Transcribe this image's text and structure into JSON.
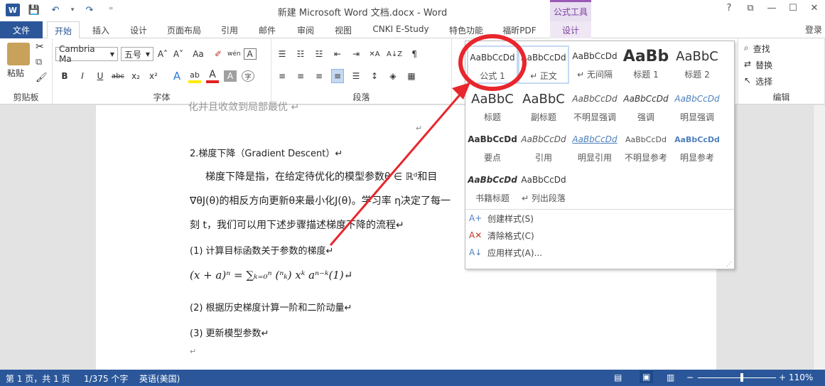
{
  "window": {
    "title": "新建 Microsoft Word 文档.docx - Word",
    "context_tab_title": "公式工具",
    "help": "?",
    "restore_ribbon": "⧉",
    "minimize": "—",
    "maximize": "☐",
    "close": "✕",
    "login": "登录"
  },
  "qat": {
    "logo": "W",
    "save": "💾",
    "undo": "↶",
    "undo_dd": "▾",
    "redo": "↷",
    "customize": "⁼"
  },
  "tabs": [
    {
      "label": "文件",
      "kind": "file"
    },
    {
      "label": "开始",
      "kind": "active"
    },
    {
      "label": "插入"
    },
    {
      "label": "设计"
    },
    {
      "label": "页面布局"
    },
    {
      "label": "引用"
    },
    {
      "label": "邮件"
    },
    {
      "label": "审阅"
    },
    {
      "label": "视图"
    },
    {
      "label": "CNKI E-Study"
    },
    {
      "label": "特色功能"
    },
    {
      "label": "福昕PDF"
    },
    {
      "label": "设计",
      "kind": "ctx"
    }
  ],
  "ribbon": {
    "clipboard": {
      "paste": "粘贴",
      "label": "剪贴板",
      "cut": "✂",
      "copy": "⧉",
      "brush": "🖌"
    },
    "font": {
      "family": "Cambria Ma",
      "size": "五号",
      "grow": "A˄",
      "shrink": "A˅",
      "case": "Aa",
      "clear": "✐",
      "phonetic": "wén",
      "border": "A",
      "bold": "B",
      "italic": "I",
      "underline": "U",
      "strike": "abc",
      "sub": "x₂",
      "sup": "x²",
      "effects": "A",
      "highlight": "ab",
      "color": "A",
      "shade": "A",
      "enclose": "字",
      "label": "字体"
    },
    "paragraph": {
      "label": "段落",
      "bullets": "☰",
      "numbering": "☷",
      "multilevel": "☳",
      "decrease": "⇤",
      "increase": "⇥",
      "chinese": "✕A",
      "sort": "A↓Z",
      "marks": "¶",
      "left": "≡",
      "center": "≡",
      "right": "≡",
      "justify": "≡",
      "distributed": "☰",
      "spacing": "↕",
      "shading": "◈",
      "borders": "▦"
    },
    "editing": {
      "label": "编辑",
      "find": "查找",
      "replace": "替换",
      "select": "选择"
    }
  },
  "styles_gallery": [
    {
      "preview": "AaBbCcDd",
      "name": "公式 1"
    },
    {
      "preview": "AaBbCcDd",
      "name": "↵ 正文"
    },
    {
      "preview": "AaBbCcDd",
      "name": "↵ 无间隔"
    },
    {
      "preview": "AaBb",
      "name": "标题 1"
    },
    {
      "preview": "AaBbC",
      "name": "标题 2"
    },
    {
      "preview": "AaBbC",
      "name": "标题"
    },
    {
      "preview": "AaBbC",
      "name": "副标题"
    },
    {
      "preview": "AaBbCcDd",
      "name": "不明显强调"
    },
    {
      "preview": "AaBbCcDd",
      "name": "强调"
    },
    {
      "preview": "AaBbCcDd",
      "name": "明显强调"
    },
    {
      "preview": "AaBbCcDd",
      "name": "要点"
    },
    {
      "preview": "AaBbCcDd",
      "name": "引用"
    },
    {
      "preview": "AaBbCcDd",
      "name": "明显引用"
    },
    {
      "preview": "AaBbCcDd",
      "name": "不明显参考"
    },
    {
      "preview": "AaBbCcDd",
      "name": "明显参考"
    },
    {
      "preview": "AaBbCcDd",
      "name": "书籍标题"
    },
    {
      "preview": "AaBbCcDd",
      "name": "↵ 列出段落"
    }
  ],
  "styles_menu": [
    {
      "icon": "A+",
      "label": "创建样式(S)"
    },
    {
      "icon": "A✕",
      "label": "清除格式(C)"
    },
    {
      "icon": "A↓",
      "label": "应用样式(A)..."
    }
  ],
  "document": {
    "cutoff_line": "化并且收敛到局部最优 ↵",
    "pilcrow1": "↵",
    "heading": "2.梯度下降（Gradient Descent）↵",
    "para1": "梯度下降是指，在给定待优化的模型参数θ ∈ ℝᵈ和目",
    "para2": "∇θJ(θ)的相反方向更新θ来最小化J(θ)。学习率 η决定了每一",
    "para3": "刻 t，我们可以用下述步骤描述梯度下降的流程↵",
    "step1": "(1)  计算目标函数关于参数的梯度↵",
    "formula": "(x + a)ⁿ = ∑ₖ₌₀ⁿ (ⁿₖ) xᵏ aⁿ⁻ᵏ(1)↵",
    "step2": "(2)  根据历史梯度计算一阶和二阶动量↵",
    "step3": "(3)  更新模型参数↵",
    "end_mark": "↵"
  },
  "status": {
    "page": "第 1 页，共 1 页",
    "words": "1/375 个字",
    "lang": "英语(美国)",
    "zoom": "110%",
    "zoom_out": "−",
    "zoom_in": "+",
    "view_read": "▤",
    "view_print": "▣",
    "view_web": "▥"
  },
  "colors": {
    "accent": "#2b579a",
    "context": "#9b59b6",
    "annotation": "#e8262c"
  }
}
